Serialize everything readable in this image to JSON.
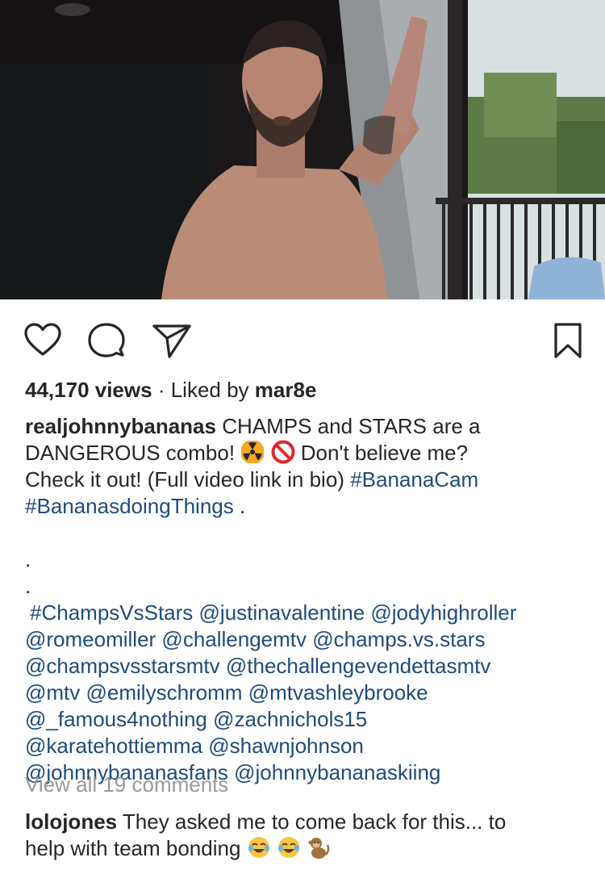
{
  "post": {
    "views": "44,170 views",
    "separator": "·",
    "liked_prefix": "Liked by",
    "liked_user": "mar8e"
  },
  "caption": {
    "username": "realjohnnybananas",
    "line1_text": "CHAMPS and STARS are a",
    "line2_text": "DANGEROUS combo!",
    "line2_after": "Don't believe me?",
    "line3_text": "Check it out! (Full video link in bio)",
    "hashtag1": "#BananaCam",
    "hashtag2": "#BananasdoingThings",
    "hashtag2_after": ".",
    "dot1": ".",
    "dot2": ".",
    "tags_line1": "#ChampsVsStars @justinavalentine @jodyhighroller",
    "tags_line2": "@romeomiller @challengemtv @champs.vs.stars",
    "tags_line3": "@champsvsstarsmtv @thechallengevendettasmtv",
    "tags_line4": "@mtv @emilyschromm @mtvashleybrooke",
    "tags_line5": "@_famous4nothing @zachnichols15",
    "tags_line6": "@karatehottiemma @shawnjohnson",
    "tags_line7": "@johnnybananasfans @johnnybananaskiing"
  },
  "comments": {
    "view_all": "View all 19 comments",
    "first": {
      "username": "lolojones",
      "line1": "They asked me to come back for this... to",
      "line2": "help with team bonding"
    }
  },
  "icons": {
    "like": "heart-icon",
    "comment": "comment-bubble-icon",
    "share": "paper-plane-icon",
    "save": "bookmark-icon",
    "emojis_caption": [
      "radioactive-emoji-icon",
      "prohibited-emoji-icon"
    ],
    "emojis_comment": [
      "tears-of-joy-emoji-icon",
      "tears-of-joy-emoji-icon",
      "monkey-emoji-icon"
    ]
  },
  "colors": {
    "text": "#262626",
    "link": "#1e4b7d",
    "muted": "#999999"
  }
}
